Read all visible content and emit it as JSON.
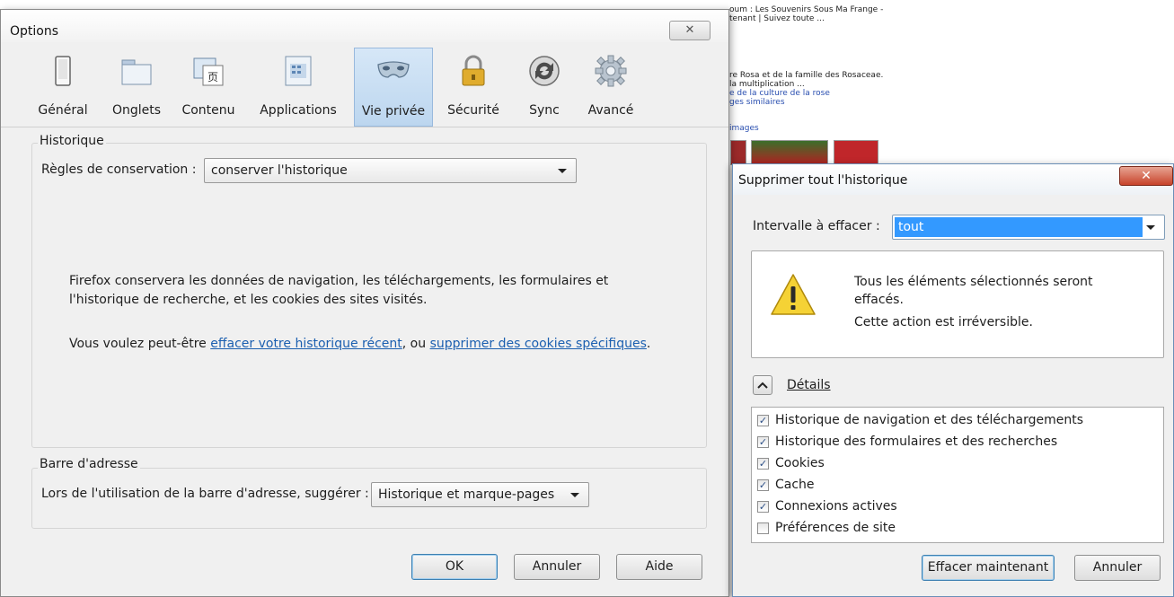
{
  "background": {
    "lines": [
      {
        "text": "oum : Les Souvenirs Sous Ma Frange -",
        "color": "dark"
      },
      {
        "text": "tenant | Suivez toute ...",
        "color": "dark"
      },
      {
        "text": "re Rosa et de la famille des Rosaceae.",
        "color": "dark"
      },
      {
        "text": "la multiplication ...",
        "color": "dark"
      },
      {
        "text": "e de la culture de la rose",
        "color": "blue"
      },
      {
        "text": "ges similaires",
        "color": "blue"
      },
      {
        "text": "images",
        "color": "blue"
      }
    ]
  },
  "options": {
    "title": "Options",
    "close_glyph": "✕",
    "tabs": [
      {
        "label": "Général",
        "icon": "general-icon"
      },
      {
        "label": "Onglets",
        "icon": "tabs-icon"
      },
      {
        "label": "Contenu",
        "icon": "content-icon"
      },
      {
        "label": "Applications",
        "icon": "applications-icon"
      },
      {
        "label": "Vie privée",
        "icon": "privacy-mask-icon",
        "selected": true
      },
      {
        "label": "Sécurité",
        "icon": "padlock-icon"
      },
      {
        "label": "Sync",
        "icon": "sync-icon"
      },
      {
        "label": "Avancé",
        "icon": "gear-icon"
      }
    ],
    "history": {
      "caption": "Historique",
      "rules_label": "Règles de conservation :",
      "rules_value": "conserver l'historique",
      "desc_line1": "Firefox conservera les données de navigation, les téléchargements, les formulaires et",
      "desc_line2": "l'historique de recherche, et les cookies des sites visités.",
      "suggest_prefix": "Vous voulez peut-être ",
      "link1": "effacer votre historique récent",
      "middle": ", ou ",
      "link2": "supprimer des cookies spécifiques",
      "suffix": "."
    },
    "addressbar": {
      "caption": "Barre d'adresse",
      "label": "Lors de l'utilisation de la barre d'adresse, suggérer :",
      "value": "Historique et marque-pages"
    },
    "buttons": {
      "ok": "OK",
      "cancel": "Annuler",
      "help": "Aide"
    }
  },
  "clear_dialog": {
    "title": "Supprimer tout l'historique",
    "close_glyph": "✕",
    "interval_label": "Intervalle à effacer :",
    "interval_value": "tout",
    "warning_line1": "Tous les éléments sélectionnés seront",
    "warning_line2": "effacés.",
    "warning_line3": "Cette action est irréversible.",
    "details_label": "Détails",
    "items": [
      {
        "label": "Historique de navigation et des téléchargements",
        "checked": true
      },
      {
        "label": "Historique des formulaires et des recherches",
        "checked": true
      },
      {
        "label": "Cookies",
        "checked": true
      },
      {
        "label": "Cache",
        "checked": true
      },
      {
        "label": "Connexions actives",
        "checked": true
      },
      {
        "label": "Préférences de site",
        "checked": false
      }
    ],
    "check_glyph": "✓",
    "buttons": {
      "clear_now": "Effacer maintenant",
      "cancel": "Annuler"
    }
  },
  "colors": {
    "selected_tab": "#bcd6ef",
    "link": "#1b5fb0",
    "selection": "#3399ff",
    "close_red": "#c7432a"
  }
}
